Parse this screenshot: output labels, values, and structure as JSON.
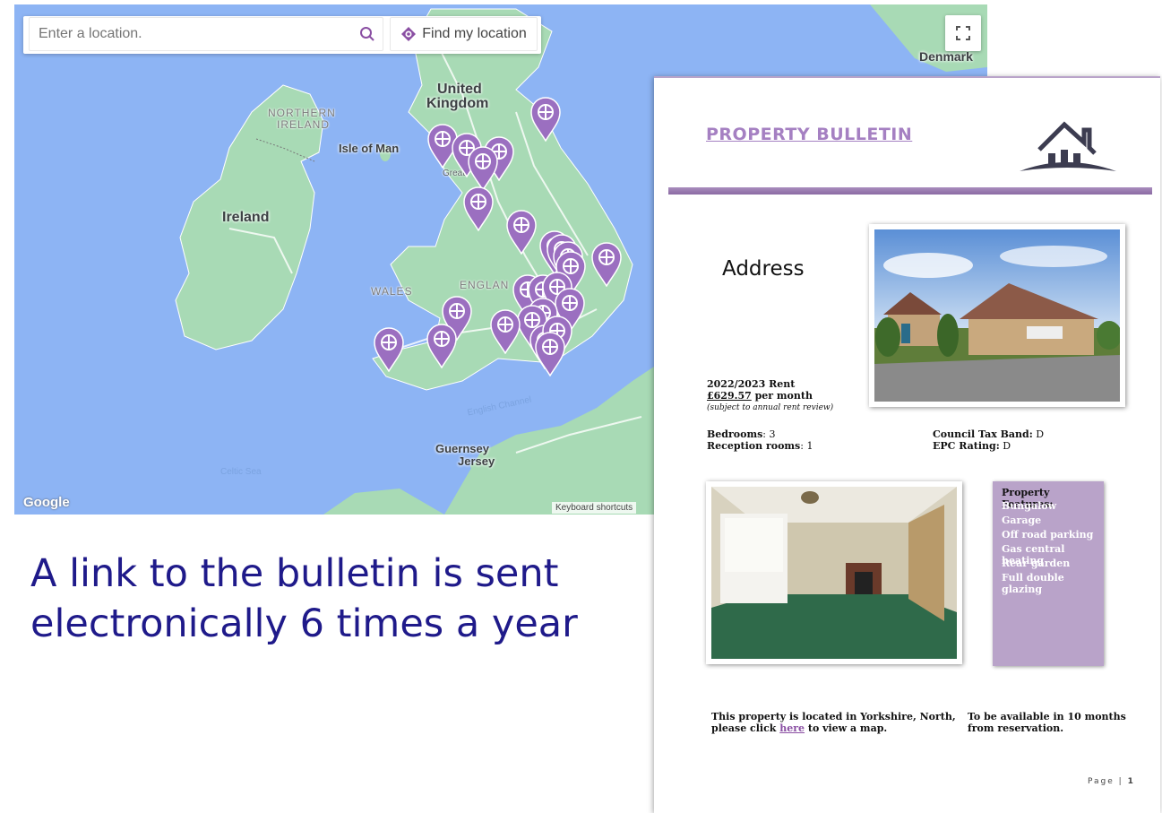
{
  "map": {
    "search_placeholder": "Enter a location.",
    "find_location_label": "Find my location",
    "labels": {
      "united_kingdom_1": "United",
      "united_kingdom_2": "Kingdom",
      "northern_ireland_1": "NORTHERN",
      "northern_ireland_2": "IRELAND",
      "isle_of_man": "Isle of Man",
      "ireland": "Ireland",
      "wales": "WALES",
      "england": "ENGLAN",
      "great": "Great",
      "english_channel": "English Channel",
      "guernsey": "Guernsey",
      "jersey": "Jersey",
      "celtic_sea": "Celtic Sea",
      "denmark": "Denmark"
    },
    "google_logo": "Google",
    "keyboard_shortcuts": "Keyboard shortcuts",
    "colors": {
      "water": "#8db4f4",
      "land": "#a8dab5",
      "pin": "#9b6fc0"
    }
  },
  "caption": "A link to the bulletin is sent electronically 6 times a year",
  "bulletin": {
    "title": "PROPERTY BULLETIN",
    "address": "Address",
    "rent_heading": "2022/2023 Rent",
    "rent_amount": "£629.57",
    "rent_period": " per month",
    "rent_note": "(subject to annual rent review)",
    "bedrooms_label": "Bedrooms",
    "bedrooms_value": ": 3",
    "reception_label": "Reception rooms",
    "reception_value": ": 1",
    "council_tax_label": "Council Tax Band:",
    "council_tax_value": " D",
    "epc_label": "EPC Rating:",
    "epc_value": " D",
    "features_heading": "Property Features:",
    "features": [
      "Bungalow",
      "Garage",
      "Off road parking",
      "Gas central heating",
      "Rear garden",
      "Full double glazing"
    ],
    "location_text_1": "This property is located in Yorkshire, North,",
    "location_text_2a": "please click ",
    "location_link": "here",
    "location_text_2b": " to view a map.",
    "availability_1": "To be available in 10 months",
    "availability_2": "from reservation.",
    "page_label": "Page |",
    "page_number": "1",
    "colors": {
      "accent": "#a580c2",
      "features_bg": "#b9a3c9"
    }
  }
}
